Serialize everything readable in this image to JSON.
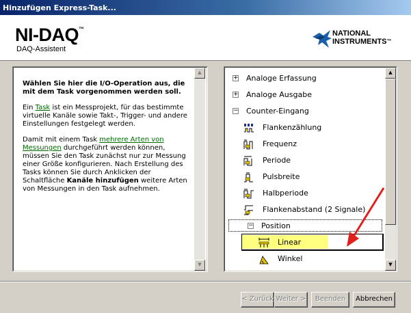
{
  "window": {
    "title": "Hinzufügen Express-Task..."
  },
  "header": {
    "product": "NI-DAQ",
    "trademark": "™",
    "subtitle": "DAQ-Assistent",
    "vendor_line1": "NATIONAL",
    "vendor_line2": "INSTRUMENTS",
    "vendor_tm": "™"
  },
  "help": {
    "heading": "Wählen Sie hier die I/O-Operation aus, die mit dem Task vorgenommen werden soll.",
    "p1_before": "Ein ",
    "p1_link": "Task",
    "p1_after": " ist ein Messprojekt, für das bestimmte virtuelle Kanäle sowie Takt-, Trigger- und andere Einstellungen festgelegt werden.",
    "p2_before": "Damit mit einem Task ",
    "p2_link": "mehrere Arten von Messungen",
    "p2_middle": " durchgeführt werden können, müssen Sie den Task zunächst nur zur Messung einer Größe konfigurieren. Nach Erstellung des Tasks können Sie durch Anklicken der Schaltfläche ",
    "p2_bold": "Kanäle hinzufügen",
    "p2_after": " weitere Arten von Messungen in den Task aufnehmen."
  },
  "tree": {
    "items": [
      {
        "label": "Analoge Erfassung",
        "expander": "+"
      },
      {
        "label": "Analoge Ausgabe",
        "expander": "+"
      },
      {
        "label": "Counter-Eingang",
        "expander": "−"
      },
      {
        "label": "Flankenzählung",
        "icon": "edge-count-icon"
      },
      {
        "label": "Frequenz",
        "icon": "frequency-icon"
      },
      {
        "label": "Periode",
        "icon": "period-icon"
      },
      {
        "label": "Pulsbreite",
        "icon": "pulse-width-icon"
      },
      {
        "label": "Halbperiode",
        "icon": "semi-period-icon"
      },
      {
        "label": "Flankenabstand (2 Signale)",
        "icon": "two-edge-separation-icon"
      },
      {
        "label": "Position",
        "expander": "−"
      },
      {
        "label": "Linear",
        "icon": "linear-encoder-icon"
      },
      {
        "label": "Winkel",
        "icon": "angular-encoder-icon"
      }
    ]
  },
  "buttons": {
    "back": "< Zurück",
    "next": "Weiter >",
    "finish": "Beenden",
    "cancel": "Abbrechen"
  },
  "colors": {
    "selection": "#ffff7f",
    "link": "#006a00",
    "arrow": "#e0201c"
  }
}
